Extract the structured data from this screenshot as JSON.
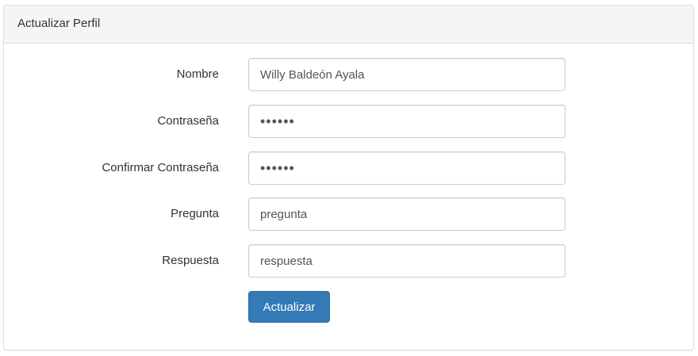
{
  "panel": {
    "title": "Actualizar Perfil"
  },
  "form": {
    "fields": [
      {
        "label": "Nombre",
        "value": "Willy Baldeón Ayala",
        "type": "text"
      },
      {
        "label": "Contraseña",
        "value": "......",
        "type": "password"
      },
      {
        "label": "Confirmar Contraseña",
        "value": "......",
        "type": "password"
      },
      {
        "label": "Pregunta",
        "value": "pregunta",
        "type": "text"
      },
      {
        "label": "Respuesta",
        "value": "respuesta",
        "type": "text"
      }
    ],
    "submit_label": "Actualizar"
  },
  "colors": {
    "primary_button": "#337ab7",
    "heading_background": "#f5f5f5",
    "border": "#dddddd"
  }
}
